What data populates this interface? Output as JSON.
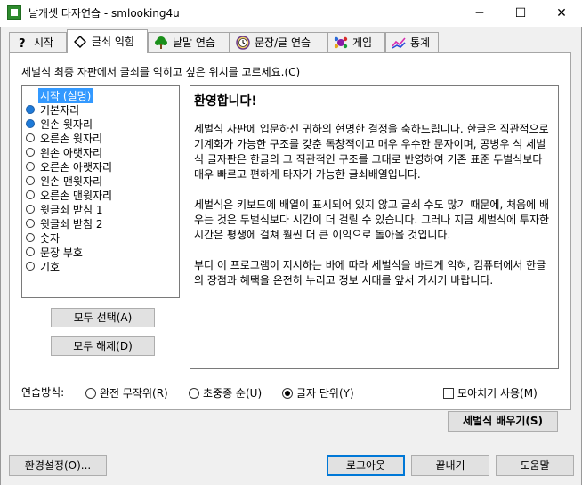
{
  "window": {
    "title": "날개셋 타자연습 - smlooking4u",
    "controls": {
      "minimize": "─",
      "maximize": "☐",
      "close": "✕"
    }
  },
  "tabs": [
    {
      "label": "시작",
      "icon": "help-question-icon"
    },
    {
      "label": "글쇠 익힘",
      "icon": "diamond-icon",
      "active": true
    },
    {
      "label": "낱말 연습",
      "icon": "tree-icon"
    },
    {
      "label": "문장/글 연습",
      "icon": "clock-icon"
    },
    {
      "label": "게임",
      "icon": "game-icon"
    },
    {
      "label": "통계",
      "icon": "chart-icon"
    }
  ],
  "instruction": "세벌식 최종 자판에서 글쇠를 익히고 싶은 위치를 고르세요.(C)",
  "positions": [
    {
      "label": "시작 (설명)",
      "checked": false,
      "selected": true
    },
    {
      "label": "기본자리",
      "checked": true
    },
    {
      "label": "왼손 윗자리",
      "checked": true
    },
    {
      "label": "오른손 윗자리",
      "checked": false
    },
    {
      "label": "왼손 아랫자리",
      "checked": false
    },
    {
      "label": "오른손 아랫자리",
      "checked": false
    },
    {
      "label": "왼손 맨윗자리",
      "checked": false
    },
    {
      "label": "오른손 맨윗자리",
      "checked": false
    },
    {
      "label": "윗글쇠 받침 1",
      "checked": false
    },
    {
      "label": "윗글쇠 받침 2",
      "checked": false
    },
    {
      "label": "숫자",
      "checked": false
    },
    {
      "label": "문장 부호",
      "checked": false
    },
    {
      "label": "기호",
      "checked": false
    }
  ],
  "buttons": {
    "select_all": "모두 선택(A)",
    "deselect_all": "모두 해제(D)",
    "learn_sebeolsik": "세벌식 배우기(S)",
    "settings": "환경설정(O)...",
    "logout": "로그아웃",
    "exit": "끝내기",
    "help": "도움말"
  },
  "description": {
    "heading": "환영합니다!",
    "paragraphs": [
      "세벌식 자판에 입문하신 귀하의 현명한 결정을 축하드립니다. 한글은 직관적으로 기계화가 가능한 구조를 갖춘 독창적이고 매우 우수한 문자이며, 공병우 식 세벌식 글자판은 한글의 그 직관적인 구조를 그대로 반영하여 기존 표준 두벌식보다 매우 빠르고 편하게 타자가 가능한 글쇠배열입니다.",
      "세벌식은 키보드에 배열이 표시되어 있지 않고 글쇠 수도 많기 때문에, 처음에 배우는 것은 두벌식보다 시간이 더 걸릴 수 있습니다. 그러나 지금 세벌식에 투자한 시간은 평생에 걸쳐 훨씬 더 큰 이익으로 돌아올 것입니다.",
      "부디 이 프로그램이 지시하는 바에 따라 세벌식을 바르게 익혀, 컴퓨터에서 한글의 장점과 혜택을 온전히 누리고 정보 시대를 앞서 가시기 바랍니다."
    ]
  },
  "practice_mode": {
    "label": "연습방식:",
    "options": [
      {
        "label": "완전 무작위(R)",
        "selected": false
      },
      {
        "label": "초중종 순(U)",
        "selected": false
      },
      {
        "label": "글자 단위(Y)",
        "selected": true
      }
    ],
    "combine_label": "모아치기 사용(M)",
    "combine_checked": false
  },
  "colors": {
    "selection": "#3399ff",
    "radio_checked": "#1e7ad8",
    "default_button_border": "#0078d7"
  }
}
